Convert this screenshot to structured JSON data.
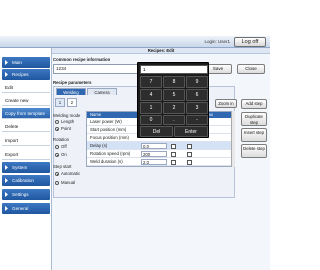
{
  "header": {
    "user": "Login: User1",
    "logoff": "Log off",
    "title": "Recipes: Edit"
  },
  "sidebar": {
    "main": "Main",
    "recipes": "Recipes",
    "sub_items": [
      "Edit",
      "Create new",
      "Copy from template",
      "Delete",
      "Import",
      "Export"
    ],
    "selected_index": 2,
    "system": "System",
    "calibration": "Calibration",
    "settings": "Settings",
    "general": "General"
  },
  "recipe_info": {
    "label": "Common recipe information",
    "value": "1234",
    "print": "Print",
    "save": "Save",
    "close": "Close"
  },
  "params": {
    "label": "Recipe parameters",
    "tabs": [
      "Welding",
      "Camera"
    ],
    "subtabs": [
      "1",
      "2"
    ],
    "welding_mode_label": "Welding mode",
    "welding_modes": [
      "Length",
      "Point"
    ],
    "welding_mode_selected": 1,
    "rotation_label": "Rotation",
    "rotation_options": [
      "Off",
      "On"
    ],
    "rotation_selected": 1,
    "step_start_label": "Step start",
    "step_start_options": [
      "Automatic",
      "Manual"
    ],
    "step_start_selected": 0,
    "table_header": {
      "name": "Name",
      "extra": "Max"
    },
    "rows": [
      {
        "name": "Laser power (W)",
        "value": ""
      },
      {
        "name": "Start position (mm)",
        "value": ""
      },
      {
        "name": "Focus position (mm)",
        "value": ""
      },
      {
        "name": "Delay (s)",
        "value": "0.0"
      },
      {
        "name": "Rotation speed (rpm)",
        "value": "200"
      },
      {
        "name": "Weld duration (s)",
        "value": "2.0"
      }
    ],
    "selected_row": 3,
    "zoom_in": "Zoom in",
    "add_step": "Add step",
    "duplicate_step": "Duplicate step",
    "insert_step": "Insert step",
    "delete_step": "Delete step"
  },
  "keypad": {
    "value": "1",
    "keys": [
      "7",
      "8",
      "9",
      "4",
      "5",
      "6",
      "1",
      "2",
      "3",
      "0",
      ".",
      "-"
    ],
    "del": "Del",
    "enter": "Enter"
  }
}
